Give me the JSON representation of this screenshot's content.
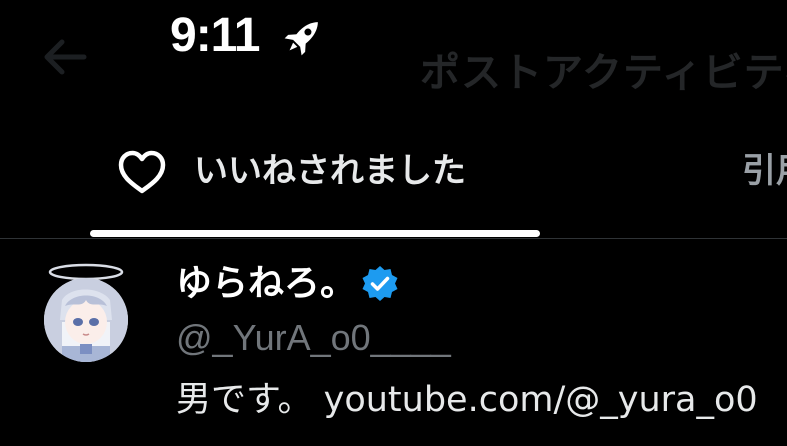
{
  "status_bar": {
    "time": "9:11",
    "activity_icon": "rocket-icon"
  },
  "header": {
    "back_icon": "back-arrow-icon",
    "title": "ポストアクティビティ"
  },
  "tabs": [
    {
      "label": "いいねされました",
      "icon": "heart-outline-icon",
      "selected": true
    },
    {
      "label": "引用"
    }
  ],
  "users": [
    {
      "display_name": "ゆらねろ。",
      "verified_icon": "verified-badge-icon",
      "handle": "@_YurA_o0____",
      "bio": "男です。 youtube.com/@_yura_o0"
    }
  ],
  "colors": {
    "background": "#000000",
    "text_primary": "#e7e9ea",
    "text_secondary": "#71767b",
    "verified_blue": "#1d9bf0",
    "tab_indicator": "#ffffff",
    "divider": "#2f3336"
  }
}
